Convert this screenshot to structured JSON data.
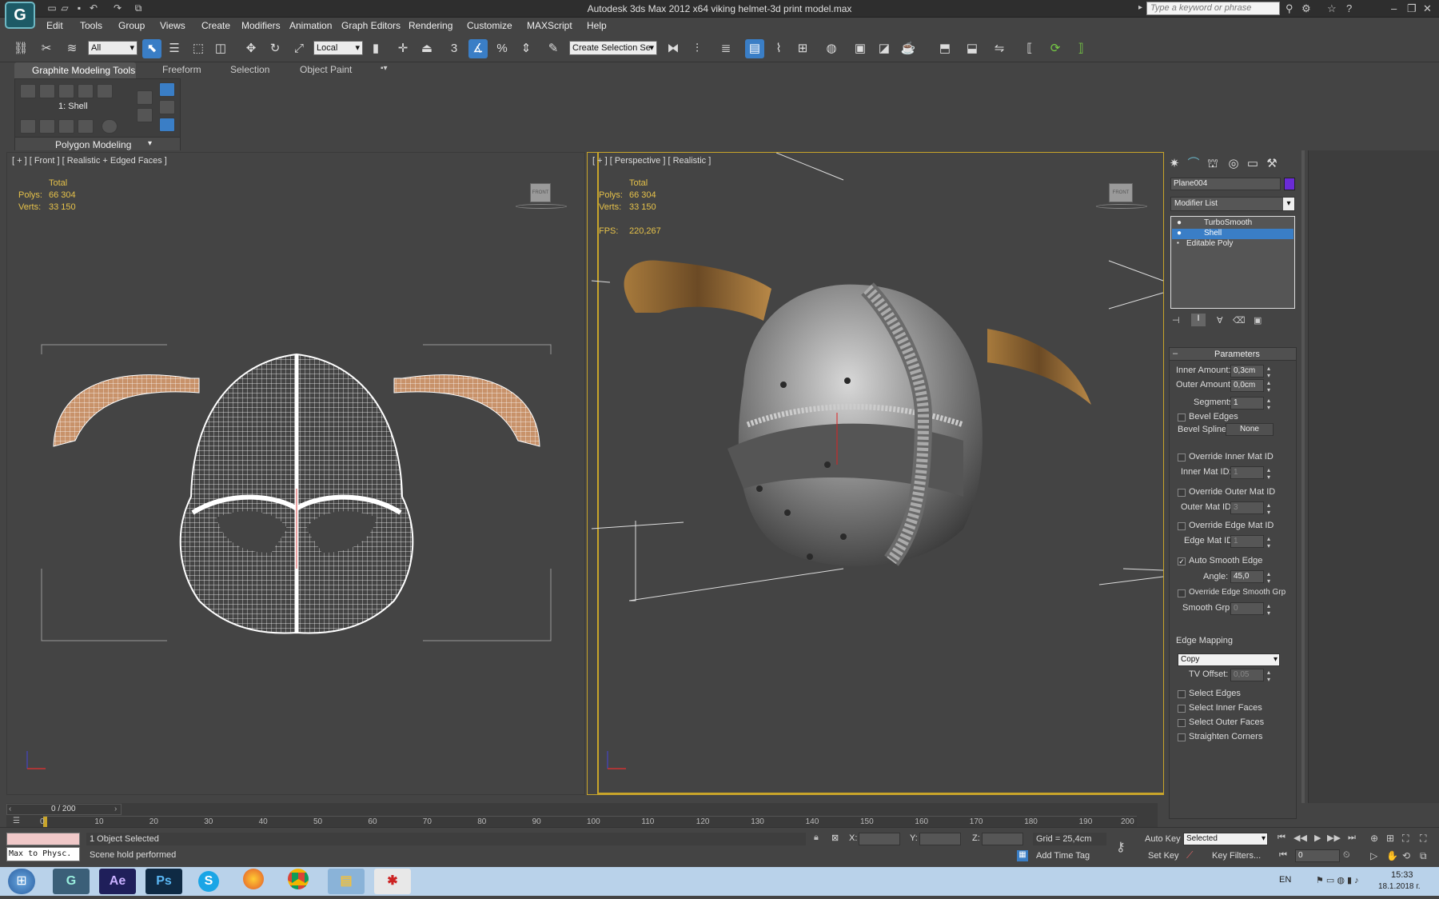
{
  "app": {
    "logo": "G",
    "title": "Autodesk 3ds Max  2012 x64      viking helmet-3d print model.max",
    "search_placeholder": "Type a keyword or phrase"
  },
  "menu": [
    "Edit",
    "Tools",
    "Group",
    "Views",
    "Create",
    "Modifiers",
    "Animation",
    "Graph Editors",
    "Rendering",
    "Customize",
    "MAXScript",
    "Help"
  ],
  "toolbar": {
    "filter": "All",
    "coord_system": "Local",
    "snap": "3",
    "angle_snap": "",
    "percent_snap": "%",
    "selection_set": "Create Selection Se"
  },
  "ribbon": {
    "tabs": [
      "Graphite Modeling Tools",
      "Freeform",
      "Selection",
      "Object Paint"
    ],
    "active_tab": 0,
    "level": "1: Shell",
    "panel_title": "Polygon Modeling"
  },
  "viewports": {
    "front": {
      "label": "[ + ] [ Front ] [ Realistic + Edged Faces ]",
      "total": "Total",
      "polys_label": "Polys:",
      "polys": "66 304",
      "verts_label": "Verts:",
      "verts": "33 150",
      "viewcube": "FRONT"
    },
    "perspective": {
      "label": "[ + ] [ Perspective ] [ Realistic ]",
      "total": "Total",
      "polys_label": "Polys:",
      "polys": "66 304",
      "verts_label": "Verts:",
      "verts": "33 150",
      "fps_label": "FPS:",
      "fps": "220,267",
      "viewcube": "FRONT"
    }
  },
  "command_panel": {
    "object_name": "Plane004",
    "object_color": "#6a2bd6",
    "modifier_list": "Modifier List",
    "stack": [
      {
        "name": "TurboSmooth",
        "selected": false
      },
      {
        "name": "Shell",
        "selected": true
      },
      {
        "name": "Editable Poly",
        "selected": false
      }
    ],
    "rollout_title": "Parameters",
    "inner_amount_label": "Inner Amount:",
    "inner_amount": "0,3cm",
    "outer_amount_label": "Outer Amount:",
    "outer_amount": "0,0cm",
    "segments_label": "Segments:",
    "segments": "1",
    "bevel_edges": "Bevel Edges",
    "bevel_spline_label": "Bevel Spline:",
    "bevel_spline": "None",
    "override_inner": "Override Inner Mat ID",
    "inner_mat_label": "Inner Mat ID:",
    "inner_mat": "1",
    "override_outer": "Override Outer Mat ID",
    "outer_mat_label": "Outer Mat ID:",
    "outer_mat": "3",
    "override_edge": "Override Edge Mat ID",
    "edge_mat_label": "Edge Mat ID:",
    "edge_mat": "1",
    "auto_smooth": "Auto Smooth Edge",
    "angle_label": "Angle:",
    "angle": "45,0",
    "override_smooth": "Override Edge Smooth Grp",
    "smooth_grp_label": "Smooth Grp:",
    "smooth_grp": "0",
    "edge_mapping_label": "Edge Mapping",
    "edge_mapping": "Copy",
    "tv_offset_label": "TV Offset:",
    "tv_offset": "0,05",
    "select_edges": "Select Edges",
    "select_inner": "Select Inner Faces",
    "select_outer": "Select Outer Faces",
    "straighten": "Straighten Corners"
  },
  "timeline": {
    "frame": "0 / 200",
    "ticks": [
      "0",
      "10",
      "20",
      "30",
      "40",
      "50",
      "60",
      "70",
      "80",
      "90",
      "100",
      "110",
      "120",
      "130",
      "140",
      "150",
      "160",
      "170",
      "180",
      "190",
      "200"
    ]
  },
  "status": {
    "maxscript": "Max to Physc.",
    "selection": "1 Object Selected",
    "prompt": "Scene hold performed",
    "x_label": "X:",
    "y_label": "Y:",
    "z_label": "Z:",
    "grid": "Grid = 25,4cm",
    "add_time_tag": "Add Time Tag",
    "auto_key": "Auto Key",
    "set_key": "Set Key",
    "selected": "Selected",
    "key_filters": "Key Filters...",
    "frame_value": "0"
  },
  "taskbar": {
    "language": "EN",
    "time": "15:33",
    "date": "18.1.2018 г."
  }
}
